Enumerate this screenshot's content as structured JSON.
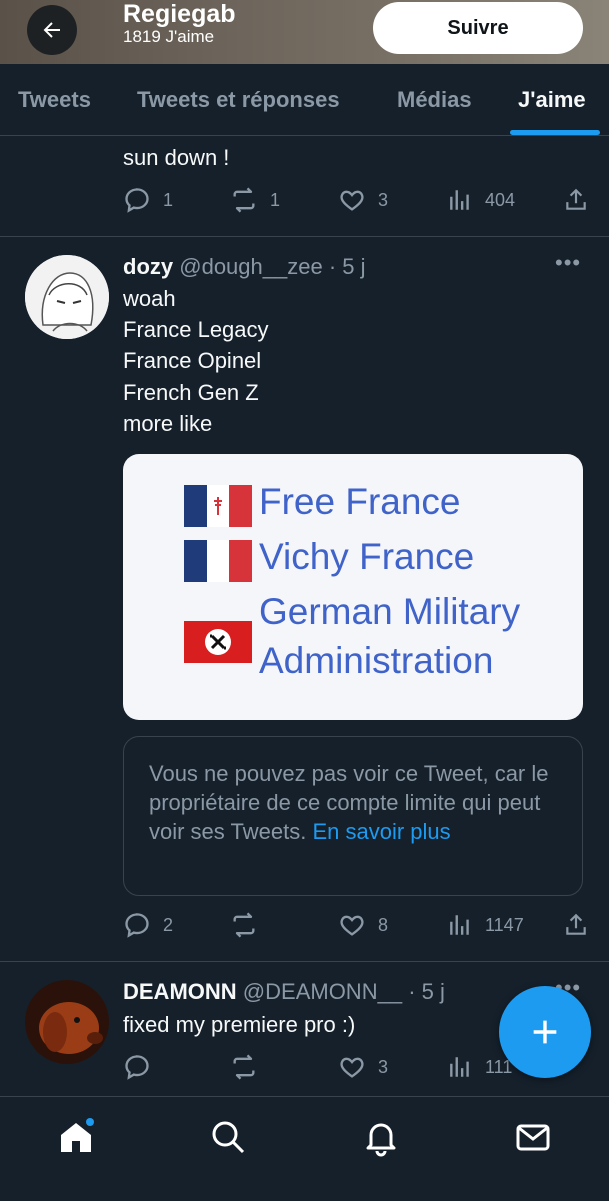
{
  "header": {
    "title": "Regiegab",
    "likes_count": "1819 J'aime",
    "follow_label": "Suivre"
  },
  "tabs": [
    {
      "label": "Tweets"
    },
    {
      "label": "Tweets et réponses"
    },
    {
      "label": "Médias"
    },
    {
      "label": "J'aime",
      "active": true
    }
  ],
  "tweet0": {
    "text_tail": "sun down !",
    "replies": "1",
    "retweets": "1",
    "likes": "3",
    "views": "404"
  },
  "tweet1": {
    "name": "dozy",
    "handle": "@dough__zee",
    "time": "· 5 j",
    "lines": [
      "woah",
      "France Legacy",
      "France Opinel",
      "French Gen Z",
      "more like"
    ],
    "media": {
      "rows": [
        "Free France",
        "Vichy France",
        "German Military",
        "Administration"
      ]
    },
    "quote": {
      "text": "Vous ne pouvez pas voir ce Tweet, car le propriétaire de ce compte limite qui peut voir ses Tweets.",
      "link": "En savoir plus"
    },
    "replies": "2",
    "retweets": "",
    "likes": "8",
    "views": "1147"
  },
  "tweet2": {
    "name": "DEAMONN",
    "handle": "@DEAMONN__",
    "time": "· 5 j",
    "text": "fixed my premiere pro :)",
    "likes": "3",
    "views": "111"
  },
  "colors": {
    "accent": "#1d9bf0",
    "background": "#15202b",
    "muted": "#8b98a5"
  },
  "icons": [
    "back-arrow-icon",
    "reply-icon",
    "retweet-icon",
    "like-icon",
    "views-icon",
    "share-icon",
    "more-icon",
    "compose-plus-icon",
    "home-icon",
    "search-icon",
    "bell-icon",
    "mail-icon"
  ]
}
